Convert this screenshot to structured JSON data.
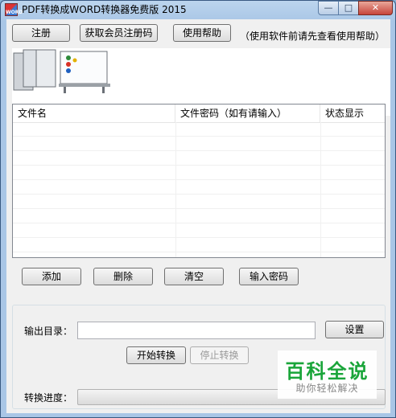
{
  "window": {
    "title": "PDF转换成WORD转换器免费版 2015",
    "app_icon_text": "WORD",
    "controls": {
      "minimize": "—",
      "maximize": "□",
      "close": "✕"
    }
  },
  "toolbar": {
    "register_label": "注册",
    "get_code_label": "获取会员注册码",
    "help_label": "使用帮助",
    "help_note": "（使用软件前请先查看使用帮助）"
  },
  "file_table": {
    "columns": [
      "文件名",
      "文件密码（如有请输入）",
      "状态显示"
    ],
    "rows": []
  },
  "actions": {
    "add_label": "添加",
    "delete_label": "删除",
    "clear_label": "清空",
    "password_label": "输入密码"
  },
  "output": {
    "dir_label": "输出目录：",
    "dir_value": "",
    "settings_label": "设置",
    "start_label": "开始转换",
    "stop_label": "停止转换",
    "progress_label": "转换进度：",
    "progress_value": 0
  },
  "watermark": {
    "main": "百科全说",
    "sub": "助你轻松解决"
  }
}
